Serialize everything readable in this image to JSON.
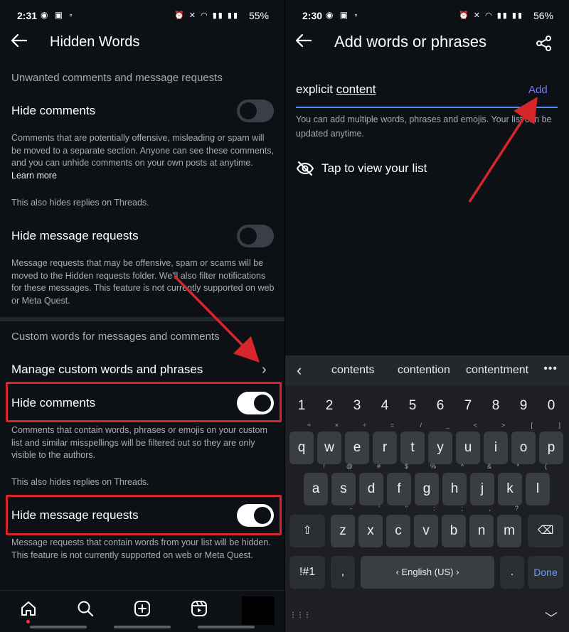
{
  "left": {
    "status": {
      "time": "2:31",
      "battery": "55%"
    },
    "header": {
      "title": "Hidden Words"
    },
    "section1": {
      "title": "Unwanted comments and message requests"
    },
    "hide_comments": {
      "label": "Hide comments",
      "on": false,
      "description": "Comments that are potentially offensive, misleading or spam will be moved to a separate section. Anyone can see these comments, and you can unhide comments on your own posts at anytime.",
      "learn_more": "Learn more",
      "threads_note": "This also hides replies on Threads."
    },
    "hide_requests": {
      "label": "Hide message requests",
      "on": false,
      "description": "Message requests that may be offensive, spam or scams will be moved to the Hidden requests folder. We'll also filter notifications for these messages. This feature is not currently supported on web or Meta Quest."
    },
    "section2": {
      "title": "Custom words for messages and comments"
    },
    "manage": {
      "label": "Manage custom words and phrases"
    },
    "custom_hide_comments": {
      "label": "Hide comments",
      "on": true,
      "description": "Comments that contain words, phrases or emojis on your custom list and similar misspellings will be filtered out so they are only visible to the authors.",
      "threads_note": "This also hides replies on Threads."
    },
    "custom_hide_requests": {
      "label": "Hide message requests",
      "on": true,
      "description": "Message requests that contain words from your list will be hidden. This feature is not currently supported on web or Meta Quest."
    },
    "navbar": [
      "home-icon",
      "search-icon",
      "create-icon",
      "reels-icon",
      "profile-avatar"
    ]
  },
  "right": {
    "status": {
      "time": "2:30",
      "battery": "56%"
    },
    "header": {
      "title": "Add words or phrases"
    },
    "input": {
      "word1": "explicit",
      "word2": "content"
    },
    "add_label": "Add",
    "description": "You can add multiple words, phrases and emojis. Your list can be updated anytime.",
    "view_list": "Tap to view your list",
    "keyboard": {
      "suggestions": [
        "contents",
        "contention",
        "contentment"
      ],
      "numbers": [
        "1",
        "2",
        "3",
        "4",
        "5",
        "6",
        "7",
        "8",
        "9",
        "0"
      ],
      "row1": [
        "q",
        "w",
        "e",
        "r",
        "t",
        "y",
        "u",
        "i",
        "o",
        "p"
      ],
      "row1_sup": [
        "+",
        "×",
        "÷",
        "=",
        "/",
        "_",
        "<",
        ">",
        "[",
        "]"
      ],
      "row2": [
        "a",
        "s",
        "d",
        "f",
        "g",
        "h",
        "j",
        "k",
        "l"
      ],
      "row2_sup": [
        "!",
        "@",
        "#",
        "$",
        "%",
        "^",
        "&",
        "*",
        "("
      ],
      "row3": [
        "z",
        "x",
        "c",
        "v",
        "b",
        "n",
        "m"
      ],
      "row3_sup": [
        "-",
        "'",
        "\"",
        ":",
        ";",
        ",",
        "?"
      ],
      "sym_label": "!#1",
      "comma": ",",
      "space_label": "English (US)",
      "period": ".",
      "done_label": "Done"
    }
  },
  "colors": {
    "highlight": "#d7262b",
    "accent": "#6b7dff",
    "toggle_on": "#ffffff",
    "toggle_off": "#3a3f47"
  }
}
